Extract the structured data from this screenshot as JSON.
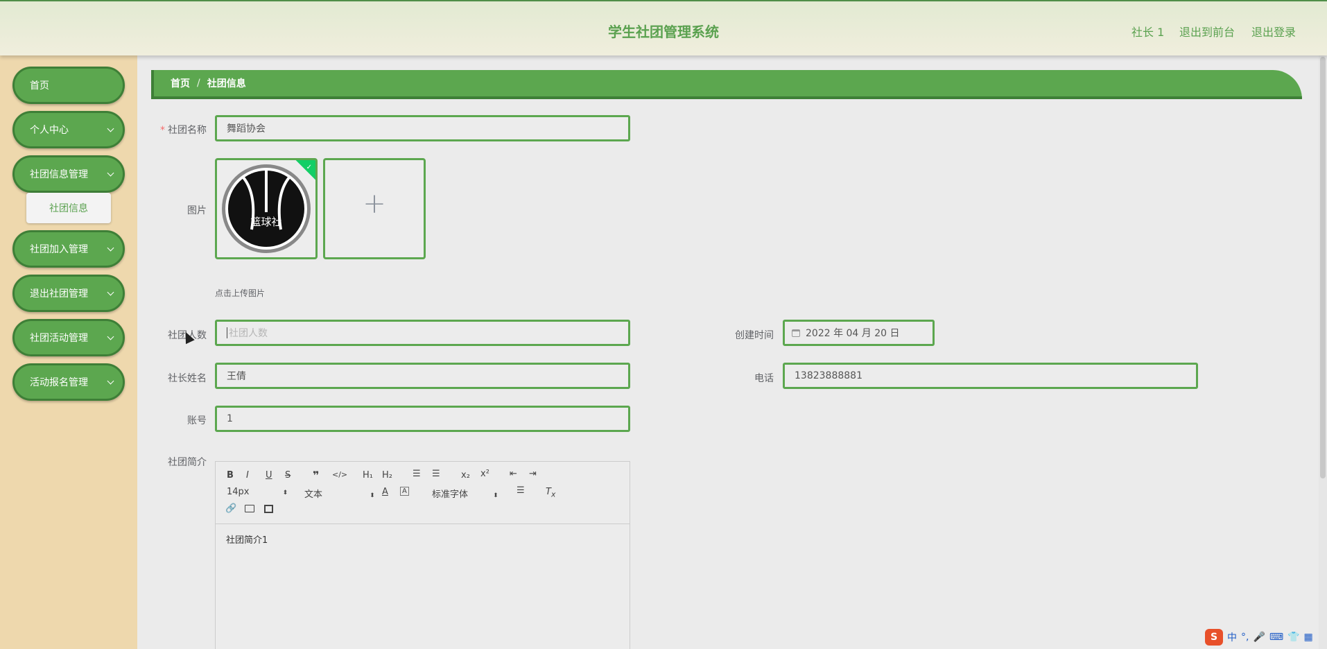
{
  "header": {
    "title": "学生社团管理系统",
    "user": "社长 1",
    "to_front": "退出到前台",
    "logout": "退出登录"
  },
  "sidebar": {
    "items": [
      {
        "label": "首页"
      },
      {
        "label": "个人中心"
      },
      {
        "label": "社团信息管理"
      },
      {
        "label": "社团加入管理"
      },
      {
        "label": "退出社团管理"
      },
      {
        "label": "社团活动管理"
      },
      {
        "label": "活动报名管理"
      }
    ],
    "sub_item": "社团信息"
  },
  "breadcrumb": {
    "home": "首页",
    "sep": "/",
    "current": "社团信息"
  },
  "form": {
    "name_label": "社团名称",
    "name_value": "舞蹈协会",
    "image_label": "图片",
    "image_text": "篮球社",
    "upload_hint": "点击上传图片",
    "count_label": "社团人数",
    "count_placeholder": "社团人数",
    "created_label": "创建时间",
    "created_value": "2022 年 04 月 20 日",
    "leader_label": "社长姓名",
    "leader_value": "王倩",
    "phone_label": "电话",
    "phone_value": "13823888881",
    "account_label": "账号",
    "account_value": "1",
    "intro_label": "社团简介",
    "intro_value": "社团简介1"
  },
  "editor": {
    "font_size": "14px",
    "text_type": "文本",
    "font_family": "标准字体"
  },
  "ime": {
    "lang": "中"
  }
}
